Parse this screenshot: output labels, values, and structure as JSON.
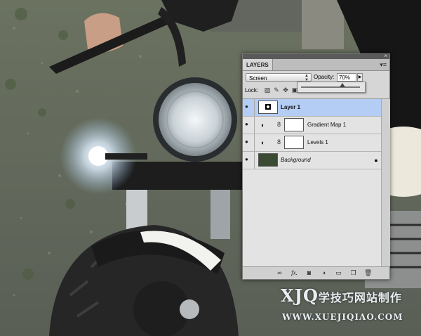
{
  "panel": {
    "tab_label": "LAYERS",
    "close_glyph": "×",
    "menu_glyph": "▾≡",
    "blend_mode": "Screen",
    "opacity_label": "Opacity:",
    "opacity_value": "70%",
    "opacity_level": 0.7,
    "lock_label": "Lock:",
    "layers": [
      {
        "name": "Layer 1",
        "style": "bold",
        "selected": true,
        "type": "pixel"
      },
      {
        "name": "Gradient Map 1",
        "style": "normal",
        "selected": false,
        "type": "adjustment"
      },
      {
        "name": "Levels 1",
        "style": "normal",
        "selected": false,
        "type": "adjustment"
      },
      {
        "name": "Background",
        "style": "italic",
        "selected": false,
        "type": "background",
        "locked": true
      }
    ],
    "bottom_icons": [
      "link-icon",
      "fx-icon",
      "mask-icon",
      "adjustment-icon",
      "folder-icon",
      "new-layer-icon",
      "trash-icon"
    ],
    "fx_label": "fx."
  },
  "watermark": {
    "latin": "XJQ",
    "chinese": "学技巧网站制作",
    "url": "WWW.XUEJIQIAO.COM"
  },
  "colors": {
    "selected_layer": "#b3cdf5",
    "panel_bg": "#d6d6d6"
  }
}
